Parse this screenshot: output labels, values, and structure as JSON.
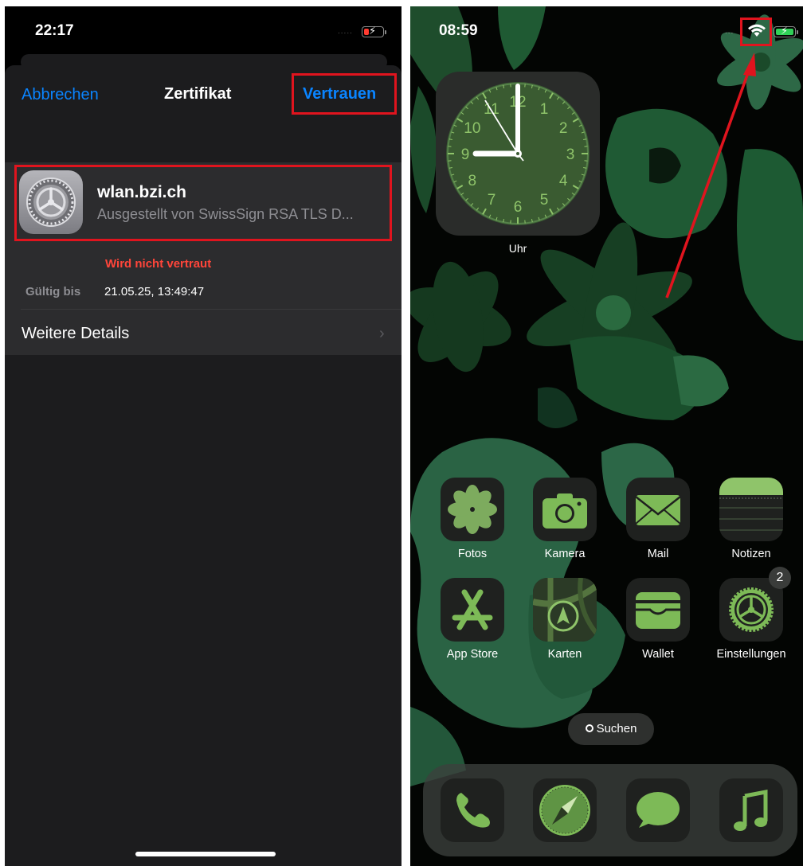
{
  "left_screen": {
    "status": {
      "time": "22:17",
      "signal_dots": "....."
    },
    "nav": {
      "cancel": "Abbrechen",
      "title": "Zertifikat",
      "trust": "Vertrauen"
    },
    "certificate": {
      "name": "wlan.bzi.ch",
      "issuer": "Ausgestellt von SwissSign RSA TLS D...",
      "status": "Wird nicht vertraut",
      "valid_label": "Gültig bis",
      "valid_value": "21.05.25, 13:49:47",
      "details": "Weitere Details",
      "chevron": "›"
    }
  },
  "right_screen": {
    "status": {
      "time": "08:59",
      "signal_dots": "..."
    },
    "clock": {
      "label": "Uhr",
      "numbers": [
        "12",
        "1",
        "2",
        "3",
        "4",
        "5",
        "6",
        "7",
        "8",
        "9",
        "10",
        "11"
      ]
    },
    "apps_row1": [
      {
        "label": "Fotos",
        "icon": "photos-icon"
      },
      {
        "label": "Kamera",
        "icon": "camera-icon"
      },
      {
        "label": "Mail",
        "icon": "mail-icon"
      },
      {
        "label": "Notizen",
        "icon": "notes-icon"
      }
    ],
    "apps_row2": [
      {
        "label": "App Store",
        "icon": "app-store-icon"
      },
      {
        "label": "Karten",
        "icon": "maps-icon"
      },
      {
        "label": "Wallet",
        "icon": "wallet-icon"
      },
      {
        "label": "Einstellungen",
        "icon": "settings-icon",
        "badge": "2"
      }
    ],
    "search": {
      "label": "Suchen",
      "icon": "search-icon"
    },
    "dock": [
      "phone-icon",
      "safari-icon",
      "messages-icon",
      "music-icon"
    ]
  },
  "colors": {
    "ios_blue": "#0a84ff",
    "destructive_red": "#ff453a",
    "annotation_red": "#e0141e",
    "accent_green": "#7dba57"
  }
}
